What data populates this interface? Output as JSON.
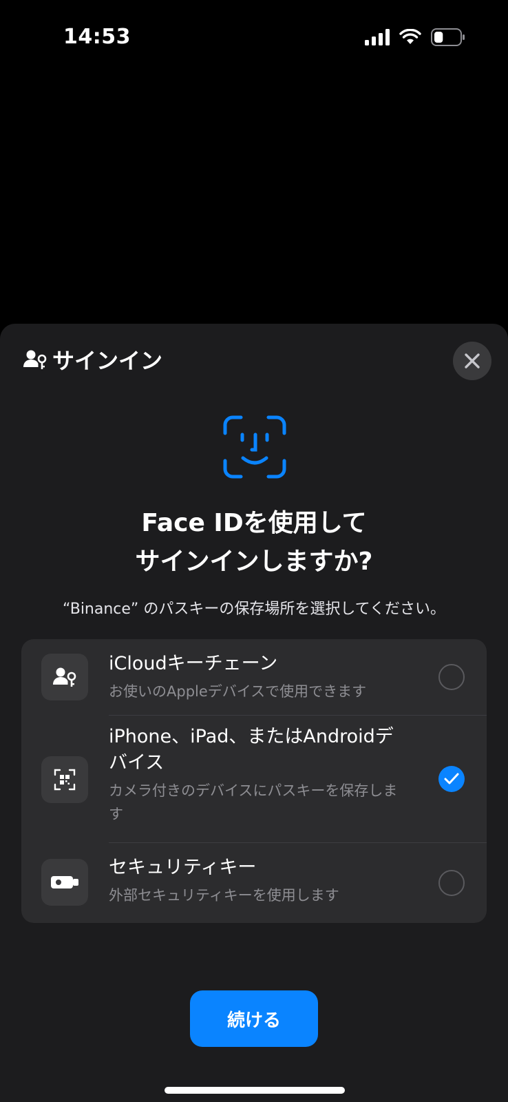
{
  "status_bar": {
    "time": "14:53",
    "icons": [
      "cellular-signal-icon",
      "wifi-icon",
      "battery-icon"
    ],
    "battery_level": 0.35
  },
  "sheet": {
    "header_icon": "person-key-icon",
    "title": "サインイン",
    "close_icon": "close-icon"
  },
  "main": {
    "faceid_icon": "face-id-icon",
    "heading_line1": "Face IDを使用して",
    "heading_line2": "サインインしますか?",
    "subtitle": "“Binance” のパスキーの保存場所を選択してください。"
  },
  "options": [
    {
      "icon": "person-key-icon",
      "title": "iCloudキーチェーン",
      "description": "お使いのAppleデバイスで使用できます",
      "selected": false
    },
    {
      "icon": "qr-code-scan-icon",
      "title": "iPhone、iPad、またはAndroidデバイス",
      "description": "カメラ付きのデバイスにパスキーを保存します",
      "selected": true
    },
    {
      "icon": "security-key-icon",
      "title": "セキュリティキー",
      "description": "外部セキュリティキーを使用します",
      "selected": false
    }
  ],
  "continue_label": "続ける",
  "colors": {
    "accent": "#0a84ff",
    "sheet_background": "#1c1c1e",
    "list_background": "#2c2c2e",
    "secondary_text": "#8e8e93"
  }
}
